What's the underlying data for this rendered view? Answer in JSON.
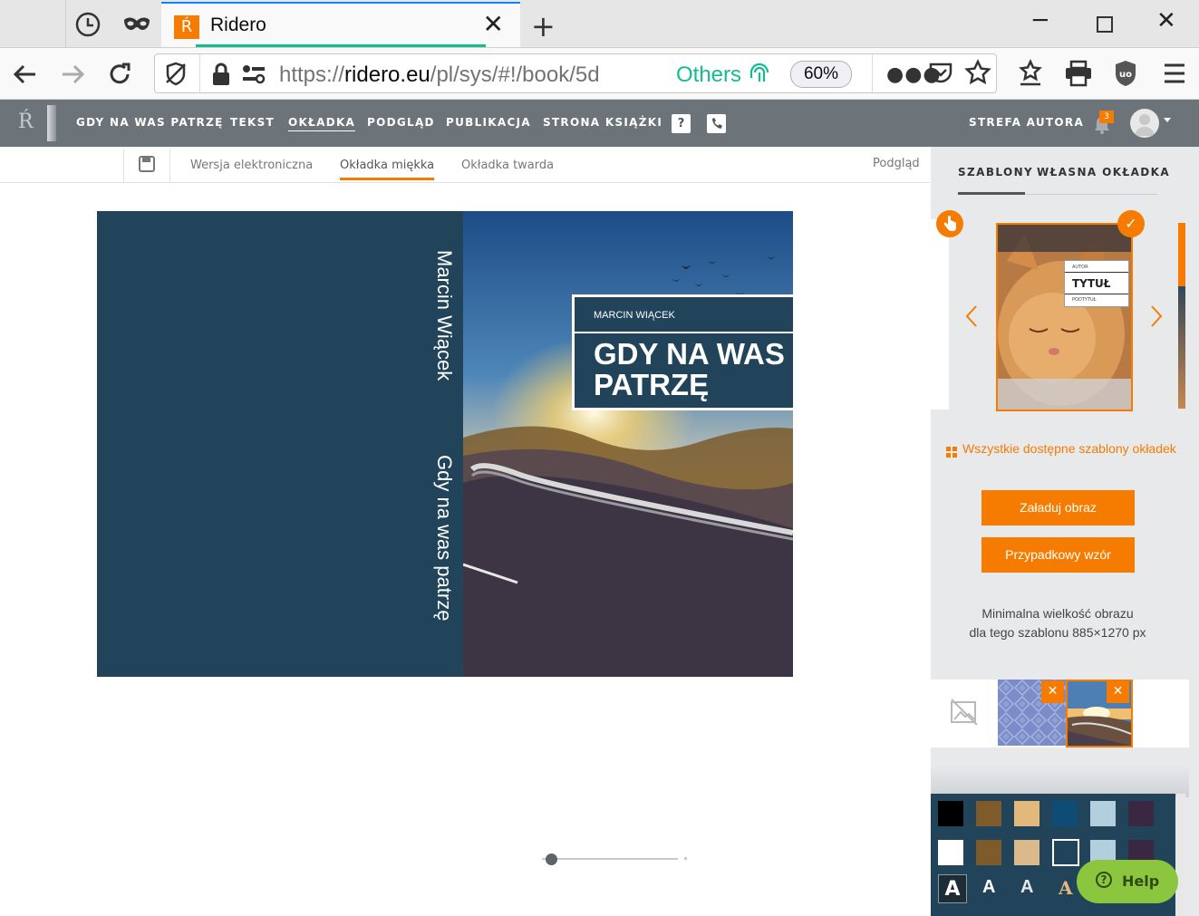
{
  "browser": {
    "tab_title": "Ridero",
    "tab_favicon": "Ŕ",
    "url_prefix": "https://",
    "url_domain": "ridero.eu",
    "url_path": "/pl/sys/#!/book/5d",
    "container_label": "Others",
    "zoom": "60%"
  },
  "app": {
    "logo": "Ŕ",
    "nav": [
      "GDY NA WAS PATRZĘ",
      "TEKST",
      "OKŁADKA",
      "PODGLĄD",
      "PUBLIKACJA",
      "STRONA KSIĄŻKI"
    ],
    "active_nav": "OKŁADKA",
    "help_q": "?",
    "author_zone": "STREFA AUTORA",
    "notif_count": "3"
  },
  "subtabs": {
    "items": [
      "Wersja elektroniczna",
      "Okładka miękka",
      "Okładka twarda"
    ],
    "active": "Okładka miękka",
    "preview": "Podgląd"
  },
  "cover": {
    "spine_author": "Marcin Wiącek",
    "spine_title": "Gdy na was patrzę",
    "front_author": "MARCIN WIĄCEK",
    "front_title_1": "GDY NA WAS",
    "front_title_2": "PATRZĘ",
    "spine_color": "#21445a",
    "zoom_slider_value": 0.05
  },
  "panel": {
    "tabs": [
      "SZABLONY",
      "WŁASNA OKŁADKA"
    ],
    "active_tab": "SZABLONY",
    "template_label_author": "AUTOR",
    "template_label_title": "TYTUŁ",
    "template_label_subtitle": "PODTYTUŁ",
    "all_templates_link": "Wszystkie dostępne szablony okładek",
    "upload_button": "Załaduj obraz",
    "random_button": "Przypadkowy wzór",
    "min_size_line1": "Minimalna wielkość obrazu",
    "min_size_line2": "dla tego szablonu 885×1270 px",
    "accent": "#f57c00",
    "swatches_row1": [
      "#000000",
      "#7f5a2a",
      "#e2b97a",
      "#0f4c75",
      "#b3cfdd",
      "#3a2842"
    ],
    "swatches_row2": [
      "#ffffff",
      "#7f5a2a",
      "#dcb98a",
      "#21445a",
      "#b3cfdd",
      "#3a2842"
    ],
    "font_samples": [
      "A",
      "A",
      "A",
      "A"
    ],
    "help": "Help"
  }
}
